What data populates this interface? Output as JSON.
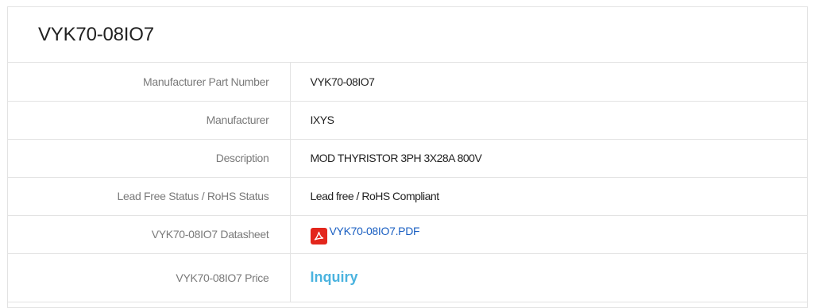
{
  "title": "VYK70-08IO7",
  "rows": [
    {
      "label": "Manufacturer Part Number",
      "value": "VYK70-08IO7"
    },
    {
      "label": "Manufacturer",
      "value": "IXYS"
    },
    {
      "label": "Description",
      "value": "MOD THYRISTOR 3PH 3X28A 800V"
    },
    {
      "label": "Lead Free Status / RoHS Status",
      "value": "Lead free / RoHS Compliant"
    },
    {
      "label": "VYK70-08IO7 Datasheet",
      "value": "VYK70-08IO7.PDF",
      "icon": "pdf-icon"
    },
    {
      "label": "VYK70-08IO7 Price",
      "value": "Inquiry"
    }
  ],
  "colors": {
    "link": "#1a5fc2",
    "inquiry": "#4ab3df",
    "pdf_icon": "#e3261c"
  }
}
